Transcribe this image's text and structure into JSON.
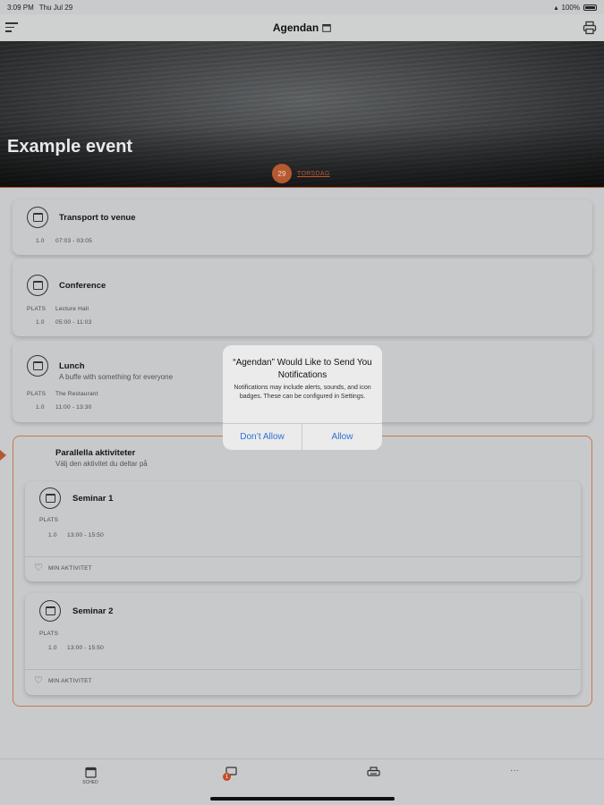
{
  "status_bar": {
    "time": "3:09 PM",
    "date": "Thu Jul 29",
    "battery": "100%"
  },
  "nav": {
    "title": "Agendan"
  },
  "hero": {
    "title": "Example event",
    "date_number": "29",
    "date_day": "TORSDAG"
  },
  "labels": {
    "plats": "PLATS",
    "index": "1.0"
  },
  "agenda": [
    {
      "title": "Transport to venue",
      "subtitle": "",
      "place": "",
      "time": "07:03 - 03:05"
    },
    {
      "title": "Conference",
      "subtitle": "",
      "place": "Lecture Hall",
      "time": "05:00 - 11:03"
    },
    {
      "title": "Lunch",
      "subtitle": "A buffe with something for everyone",
      "place": "The Restaurant",
      "time": "11:00 - 13:30"
    }
  ],
  "parallel": {
    "title": "Parallella aktiviteter",
    "subtitle": "Välj den aktivitet du deltar på",
    "sessions": [
      {
        "title": "Seminar 1",
        "time": "13:00 - 15:50",
        "action": "MIN AKTIVITET"
      },
      {
        "title": "Seminar 2",
        "time": "13:00 - 15:50",
        "action": "MIN AKTIVITET"
      }
    ]
  },
  "dialog": {
    "title": "“Agendan” Would Like to Send You Notifications",
    "message": "Notifications may include alerts, sounds, and icon badges. These can be configured in Settings.",
    "deny_label": "Don’t Allow",
    "allow_label": "Allow"
  },
  "tabbar": {
    "items": [
      {
        "label": "SCHED",
        "icon": "calendar-icon"
      },
      {
        "label": "",
        "icon": "chat-icon",
        "badge": "1"
      },
      {
        "label": "",
        "icon": "printer-icon"
      },
      {
        "label": "",
        "icon": "more-icon"
      }
    ]
  }
}
